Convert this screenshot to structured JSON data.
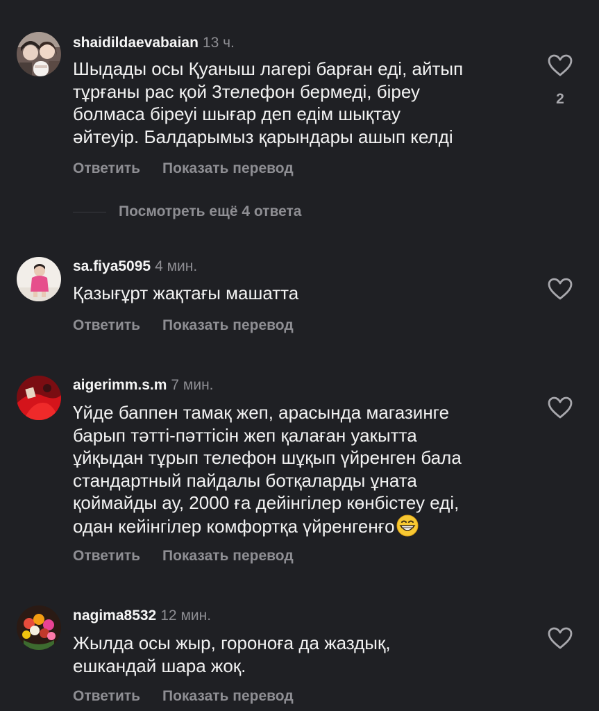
{
  "comments": [
    {
      "username": "shaidildaevabaian",
      "time": "13 ч.",
      "lines": [
        "Шыдады осы Қуаныш лагері барған еді, айтып",
        "тұрғаны рас қой 3телефон бермеді, біреу",
        "болмаса біреуі шығар деп едім шықтау",
        "әйтеуір. Балдарымыз қарындары ашып келді"
      ],
      "like_count": "2",
      "reply_label": "Ответить",
      "translate_label": "Показать перевод",
      "view_replies_label": "Посмотреть ещё 4 ответа"
    },
    {
      "username": "sa.fiya5095",
      "time": "4 мин.",
      "lines": [
        "Қазығұрт жақтағы машатта"
      ],
      "reply_label": "Ответить",
      "translate_label": "Показать перевод"
    },
    {
      "username": "aigerimm.s.m",
      "time": "7 мин.",
      "lines": [
        "Үйде баппен тамақ жеп, арасында магазинге",
        "барып тәтті-пәттісін жеп қалаған уакытта",
        "ұйқыдан тұрып телефон шұқып үйренген бала",
        "стандартный пайдалы ботқаларды ұната",
        "қоймайды ау, 2000 ға дейінгілер көнбістеу еді,",
        "одан кейінгілер комфортқа үйренгенғо"
      ],
      "emoji": "grinning-face-emoji",
      "reply_label": "Ответить",
      "translate_label": "Показать перевод"
    },
    {
      "username": "nagima8532",
      "time": "12 мин.",
      "lines": [
        "Жылда осы жыр,  гороноға да жаздық,",
        "ешкандай шара жоқ."
      ],
      "reply_label": "Ответить",
      "translate_label": "Показать перевод"
    }
  ],
  "icons": {
    "like": "heart-outline-icon"
  },
  "colors": {
    "background": "#1f2024",
    "text": "#f2f2f2",
    "secondary_text": "#8e8e93"
  }
}
